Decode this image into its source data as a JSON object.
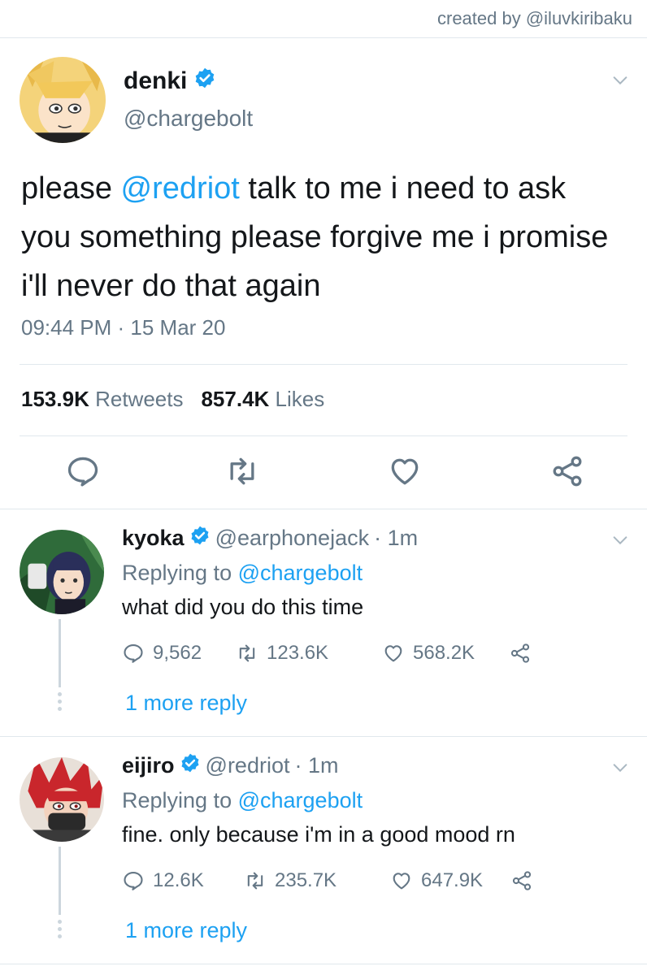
{
  "credit": "created by @iluvkiribaku",
  "main_tweet": {
    "name": "denki",
    "handle": "@chargebolt",
    "text_before": "please ",
    "mention": "@redriot",
    "text_after": " talk to me i need to ask you something please forgive me i promise i'll never do that again",
    "time": "09:44 PM · 15 Mar 20",
    "retweets_count": "153.9K",
    "retweets_label": "Retweets",
    "likes_count": "857.4K",
    "likes_label": "Likes"
  },
  "replies": [
    {
      "name": "kyoka",
      "handle": "@earphonejack",
      "age": "· 1m",
      "replying_label": "Replying to",
      "replying_to": "@chargebolt",
      "text": "what did you do this time",
      "replies": "9,562",
      "retweets": "123.6K",
      "likes": "568.2K",
      "more_label": "1 more reply"
    },
    {
      "name": "eijiro",
      "handle": "@redriot",
      "age": "· 1m",
      "replying_label": "Replying to",
      "replying_to": "@chargebolt",
      "text": "fine. only because i'm in a good mood rn",
      "replies": "12.6K",
      "retweets": "235.7K",
      "likes": "647.9K",
      "more_label": "1 more reply"
    }
  ],
  "colors": {
    "accent": "#1da1f2",
    "muted": "#657786",
    "border": "#e1e8ed"
  },
  "icons": [
    "chevron-down-icon",
    "verified-badge-icon",
    "reply-icon",
    "retweet-icon",
    "like-icon",
    "share-icon"
  ]
}
